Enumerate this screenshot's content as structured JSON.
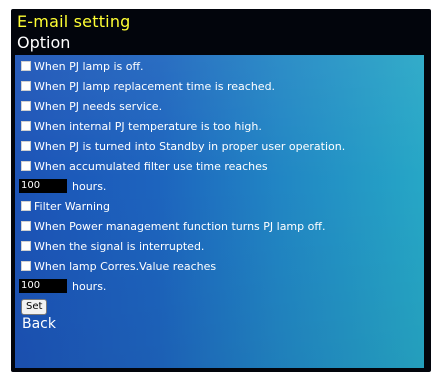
{
  "header": {
    "title": "E-mail setting",
    "subtitle": "Option"
  },
  "options": [
    {
      "label": "When PJ lamp is off.",
      "checked": false
    },
    {
      "label": "When PJ lamp replacement time is reached.",
      "checked": false
    },
    {
      "label": "When PJ needs service.",
      "checked": false
    },
    {
      "label": "When internal PJ temperature is too high.",
      "checked": false
    },
    {
      "label": "When PJ is turned into Standby in proper user operation.",
      "checked": false
    },
    {
      "label": "When accumulated filter use time reaches",
      "checked": false
    },
    {
      "label": "Filter Warning",
      "checked": false
    },
    {
      "label": "When Power management function turns PJ lamp off.",
      "checked": false
    },
    {
      "label": "When the signal is interrupted.",
      "checked": false
    },
    {
      "label": "When lamp Corres.Value reaches",
      "checked": false
    }
  ],
  "filter_hours": {
    "value": "100",
    "unit": "hours."
  },
  "lamp_hours": {
    "value": "100",
    "unit": "hours."
  },
  "set_button": "Set",
  "back_link": "Back",
  "colors": {
    "title": "#ffff33",
    "panel_left": "#1c53b7",
    "panel_right": "#26a7c6",
    "frame": "#02050c"
  }
}
